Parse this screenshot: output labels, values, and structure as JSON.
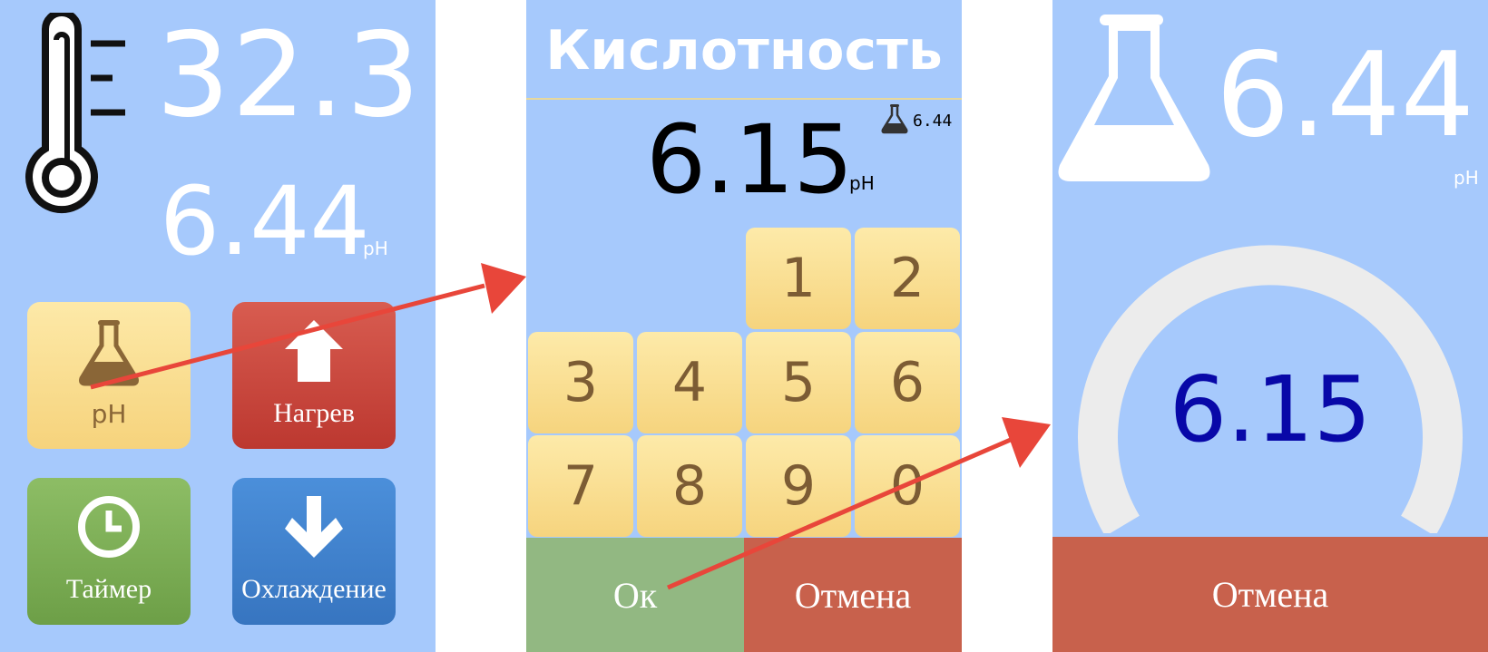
{
  "screen_main": {
    "temperature": "32.3",
    "ph_value": "6.44",
    "ph_unit": "pH",
    "tiles": [
      {
        "label": "pH",
        "icon": "flask-icon",
        "color": "#f9dc8c"
      },
      {
        "label": "Нагрев",
        "icon": "arrow-up-icon",
        "color": "#c8443a"
      },
      {
        "label": "Таймер",
        "icon": "clock-icon",
        "color": "#7cab55"
      },
      {
        "label": "Охлаждение",
        "icon": "arrow-down-icon",
        "color": "#3f82cd"
      }
    ]
  },
  "screen_keypad": {
    "title": "Кислотность",
    "entered_value": "6.15",
    "unit": "pH",
    "current_ph": "6.44",
    "keys": [
      "1",
      "2",
      "3",
      "4",
      "5",
      "6",
      "7",
      "8",
      "9",
      "0"
    ],
    "ok_label": "Ок",
    "cancel_label": "Отмена"
  },
  "screen_progress": {
    "current_ph": "6.44",
    "unit": "pH",
    "target_ph": "6.15",
    "cancel_label": "Отмена"
  },
  "colors": {
    "background": "#a6c9fc",
    "arrow": "#e8463a",
    "target_text": "#0808a8",
    "cancel": "#c8614c",
    "ok": "#92b882"
  }
}
